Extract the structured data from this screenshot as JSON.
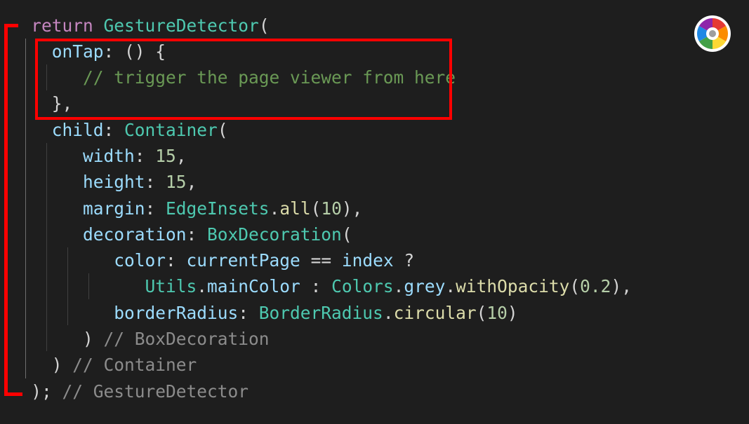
{
  "colors": {
    "background": "#1e1e1e",
    "keyword": "#c586c0",
    "class": "#4ec9b0",
    "property": "#9cdcfe",
    "function": "#dcdcaa",
    "number": "#b5cea8",
    "comment": "#6a9955",
    "closing_label": "#8c8c8c",
    "annotation": "#ff0000"
  },
  "icons": {
    "logo": "color-wheel-icon"
  },
  "code": {
    "l1": {
      "kw": "return",
      "cls": "GestureDetector",
      "p": "("
    },
    "l2": {
      "prop": "onTap",
      "p": ": () {"
    },
    "l3": {
      "cmt": "// trigger the page viewer from here"
    },
    "l4": {
      "p": "},"
    },
    "l5": {
      "prop": "child",
      "p1": ": ",
      "cls": "Container",
      "p2": "("
    },
    "l6": {
      "prop": "width",
      "p1": ": ",
      "num": "15",
      "p2": ","
    },
    "l7": {
      "prop": "height",
      "p1": ": ",
      "num": "15",
      "p2": ","
    },
    "l8": {
      "prop": "margin",
      "p1": ": ",
      "cls": "EdgeInsets",
      "p2": ".",
      "fn": "all",
      "p3": "(",
      "num": "10",
      "p4": "),"
    },
    "l9": {
      "prop": "decoration",
      "p1": ": ",
      "cls": "BoxDecoration",
      "p2": "("
    },
    "l10": {
      "prop1": "color",
      "p1": ": ",
      "prop2": "currentPage",
      "p2": " == ",
      "prop3": "index",
      "p3": " ?"
    },
    "l11": {
      "cls1": "Utils",
      "p1": ".",
      "prop1": "mainColor",
      "p2": " : ",
      "cls2": "Colors",
      "p3": ".",
      "prop2": "grey",
      "p4": ".",
      "fn": "withOpacity",
      "p5": "(",
      "num": "0.2",
      "p6": "),"
    },
    "l12": {
      "prop": "borderRadius",
      "p1": ": ",
      "cls": "BorderRadius",
      "p2": ".",
      "fn": "circular",
      "p3": "(",
      "num": "10",
      "p4": ")"
    },
    "l13": {
      "p": ")",
      "ghost": " // BoxDecoration"
    },
    "l14": {
      "p": ")",
      "ghost": " // Container"
    },
    "l15": {
      "p": ");",
      "ghost": " // GestureDetector"
    }
  }
}
